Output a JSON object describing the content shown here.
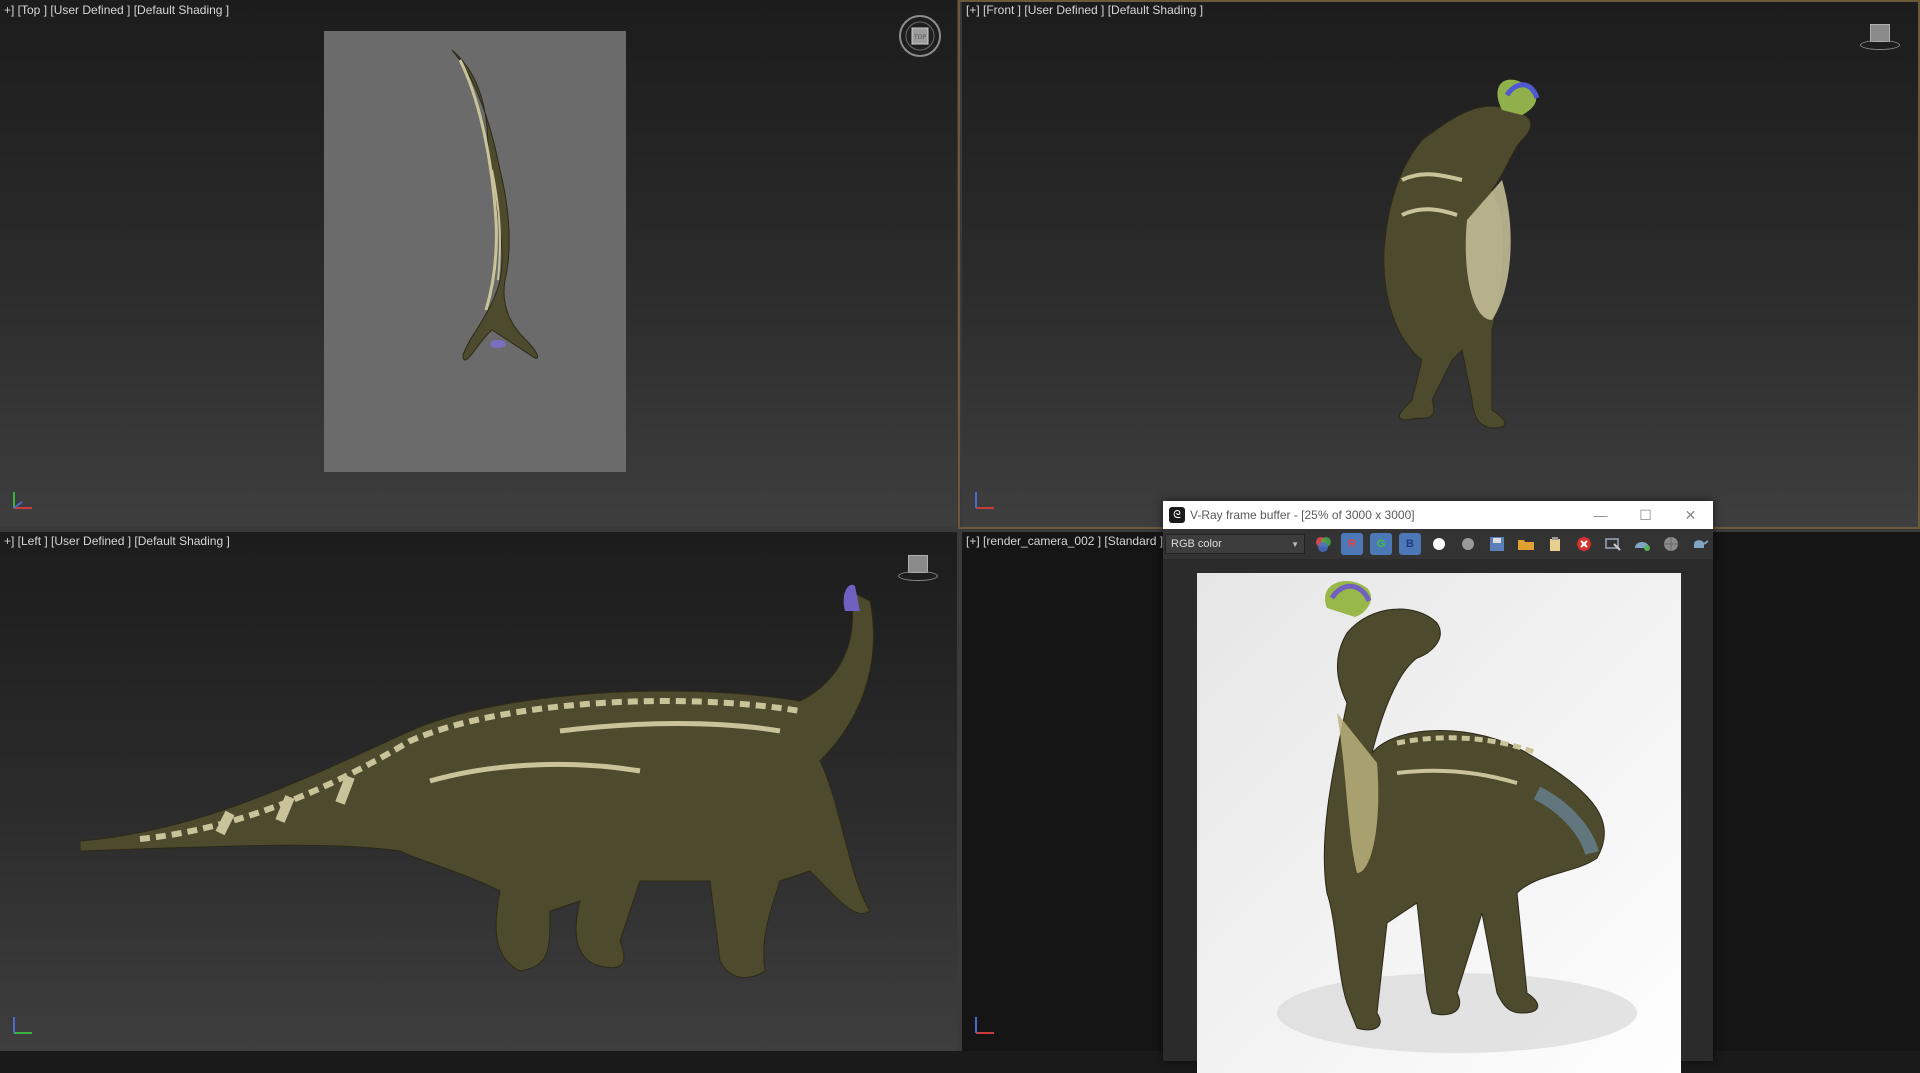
{
  "viewports": {
    "top": {
      "label": "+] [Top ] [User Defined ] [Default Shading ]"
    },
    "front": {
      "label": "[+] [Front ] [User Defined ] [Default Shading ]"
    },
    "left": {
      "label": "+] [Left ] [User Defined ] [Default Shading ]"
    },
    "camera": {
      "label": "[+] [render_camera_002 ] [Standard ] [D"
    }
  },
  "vfb": {
    "title": "V-Ray frame buffer - [25% of 3000 x 3000]",
    "channel_select": "RGB color",
    "channels": [
      "R",
      "G",
      "B"
    ],
    "window_buttons": {
      "minimize": "—",
      "maximize": "☐",
      "close": "✕"
    }
  },
  "colors": {
    "viewport_label": "#d6d6d6",
    "active_border": "#6a5a3a",
    "channel_button": "#4d78b8",
    "dino_body": "#4e4a2e",
    "dino_stripe": "#c9c39a"
  },
  "icons": [
    "viewcube-icon",
    "axis-tripod-icon",
    "vray-logo-icon",
    "color-correction-icon",
    "white-dot-icon",
    "gray-dot-icon",
    "save-icon",
    "open-icon",
    "clear-icon",
    "stop-icon",
    "track-mouse-icon",
    "region-icon",
    "render-teapot-icon"
  ]
}
